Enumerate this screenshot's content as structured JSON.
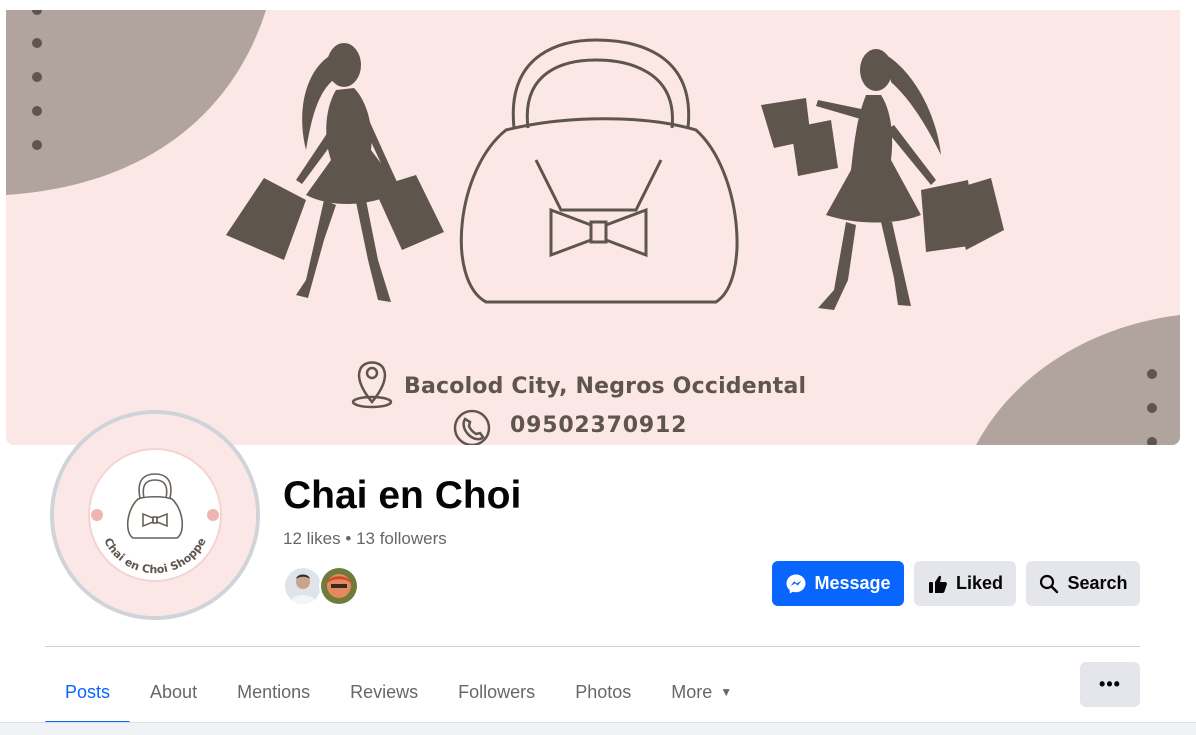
{
  "cover": {
    "address": "Bacolod City, Negros Occidental",
    "phone": "09502370912",
    "colors": {
      "background": "#fce7e7",
      "accent": "#b1a49e",
      "silhouette": "#5e554c"
    }
  },
  "profile": {
    "avatar_text": "Chai en Choi Shoppe",
    "name": "Chai en Choi",
    "likes": "12 likes",
    "separator": "•",
    "followers": "13 followers"
  },
  "actions": {
    "message_label": "Message",
    "liked_label": "Liked",
    "search_label": "Search"
  },
  "tabs": [
    {
      "label": "Posts",
      "active": true
    },
    {
      "label": "About"
    },
    {
      "label": "Mentions"
    },
    {
      "label": "Reviews"
    },
    {
      "label": "Followers"
    },
    {
      "label": "Photos"
    },
    {
      "label": "More"
    }
  ],
  "more_menu_label": "•••",
  "icons": {
    "message": "messenger-icon",
    "liked": "thumbs-up-icon",
    "search": "search-icon",
    "more_tab": "caret-down-icon",
    "address": "location-pin-icon",
    "phone": "phone-icon"
  },
  "theme": {
    "primary": "#0866ff",
    "secondary_button": "#e4e6eb",
    "muted_text": "#65676b"
  }
}
